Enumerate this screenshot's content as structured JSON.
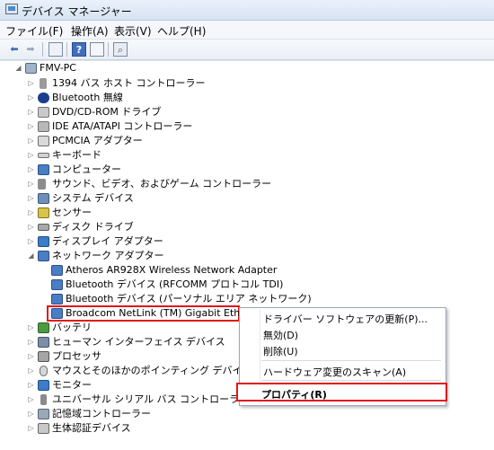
{
  "window": {
    "title": "デバイス マネージャー"
  },
  "menu": [
    "ファイル(F)",
    "操作(A)",
    "表示(V)",
    "ヘルプ(H)"
  ],
  "toolbar": {
    "icons": [
      "back-icon",
      "forward-icon",
      "properties-icon",
      "help-icon",
      "view-icon",
      "scan-hardware-icon"
    ]
  },
  "tree": {
    "root": "FMV-PC",
    "categories": [
      "1394 バス ホスト コントローラー",
      "Bluetooth 無線",
      "DVD/CD-ROM ドライブ",
      "IDE ATA/ATAPI コントローラー",
      "PCMCIA アダプター",
      "キーボード",
      "コンピューター",
      "サウンド、ビデオ、およびゲーム コントローラー",
      "システム デバイス",
      "センサー",
      "ディスク ドライブ",
      "ディスプレイ アダプター",
      "ネットワーク アダプター"
    ],
    "network_children": [
      "Atheros AR928X Wireless Network Adapter",
      "Bluetooth デバイス (RFCOMM プロトコル TDI)",
      "Bluetooth デバイス (パーソナル エリア ネットワーク)",
      "Broadcom NetLink (TM) Gigabit Ethernet"
    ],
    "categories_after": [
      "バッテリ",
      "ヒューマン インターフェイス デバイス",
      "プロセッサ",
      "マウスとそのほかのポインティング デバイス",
      "モニター",
      "ユニバーサル シリアル バス コントローラー",
      "記憶域コントローラー",
      "生体認証デバイス"
    ]
  },
  "context_menu": {
    "items": [
      "ドライバー ソフトウェアの更新(P)...",
      "無効(D)",
      "削除(U)",
      "ハードウェア変更のスキャン(A)",
      "プロパティ(R)"
    ]
  }
}
